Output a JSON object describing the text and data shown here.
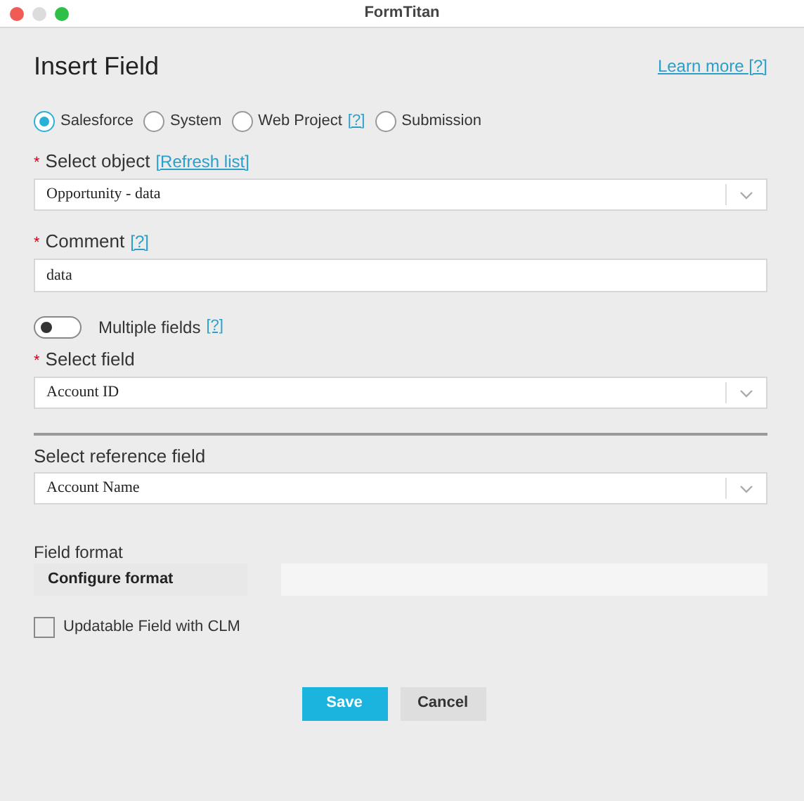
{
  "window": {
    "title": "FormTitan"
  },
  "dialog": {
    "title": "Insert Field",
    "learn_more": "Learn more [?]"
  },
  "sources": [
    {
      "label": "Salesforce",
      "selected": true
    },
    {
      "label": "System",
      "selected": false
    },
    {
      "label": "Web Project",
      "help": "[?]",
      "selected": false
    },
    {
      "label": "Submission",
      "selected": false
    }
  ],
  "select_object": {
    "label": "Select object",
    "required_mark": "*",
    "link": "[Refresh list]",
    "value": "Opportunity - data"
  },
  "comment": {
    "label": "Comment",
    "required_mark": "*",
    "help": "[?]",
    "value": "data"
  },
  "multiple_fields": {
    "label": "Multiple fields",
    "help": "[?]",
    "on": false
  },
  "select_field": {
    "label": "Select field",
    "required_mark": "*",
    "value": "Account ID"
  },
  "reference_field": {
    "label": "Select reference field",
    "value": "Account Name"
  },
  "field_format": {
    "label": "Field format",
    "button": "Configure format"
  },
  "updatable": {
    "label": "Updatable Field with CLM",
    "checked": false
  },
  "buttons": [
    {
      "label": "Save",
      "kind": "primary"
    },
    {
      "label": "Cancel",
      "kind": "secondary"
    }
  ]
}
